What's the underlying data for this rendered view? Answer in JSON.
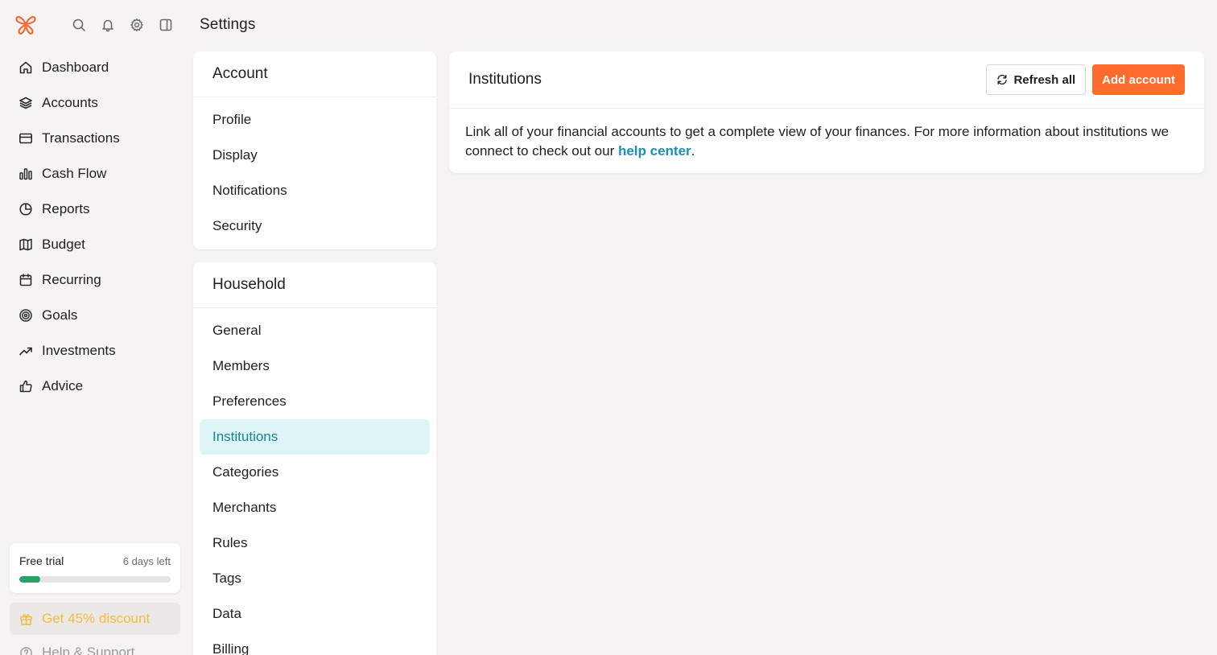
{
  "page": {
    "title": "Settings"
  },
  "topbar": {
    "icons": [
      "logo-butterfly",
      "search-icon",
      "bell-icon",
      "gear-icon",
      "sidebar-toggle-icon"
    ]
  },
  "nav": {
    "items": [
      {
        "label": "Dashboard",
        "icon": "home-icon"
      },
      {
        "label": "Accounts",
        "icon": "layers-icon"
      },
      {
        "label": "Transactions",
        "icon": "credit-card-icon"
      },
      {
        "label": "Cash Flow",
        "icon": "bar-chart-icon"
      },
      {
        "label": "Reports",
        "icon": "pie-chart-icon"
      },
      {
        "label": "Budget",
        "icon": "map-icon"
      },
      {
        "label": "Recurring",
        "icon": "calendar-icon"
      },
      {
        "label": "Goals",
        "icon": "target-icon"
      },
      {
        "label": "Investments",
        "icon": "trending-up-icon"
      },
      {
        "label": "Advice",
        "icon": "thumbs-up-icon"
      }
    ]
  },
  "trial": {
    "title": "Free trial",
    "days_left": "6 days left",
    "progress": 0.14,
    "color": "#2aa166"
  },
  "discount": {
    "label": "Get 45% discount",
    "color": "#f5b942"
  },
  "help": {
    "label": "Help & Support"
  },
  "account_section": {
    "title": "Account",
    "items": [
      "Profile",
      "Display",
      "Notifications",
      "Security"
    ]
  },
  "household_section": {
    "title": "Household",
    "items": [
      "General",
      "Members",
      "Preferences",
      "Institutions",
      "Categories",
      "Merchants",
      "Rules",
      "Tags",
      "Data",
      "Billing"
    ],
    "active": "Institutions"
  },
  "main": {
    "title": "Institutions",
    "refresh_label": "Refresh all",
    "add_label": "Add account",
    "description_before": "Link all of your financial accounts to get a complete view of your finances. For more information about institutions we connect to check out our ",
    "link_text": "help center",
    "description_after": ".",
    "accent_color": "#ff6b2c",
    "link_color": "#1b8fb8"
  }
}
